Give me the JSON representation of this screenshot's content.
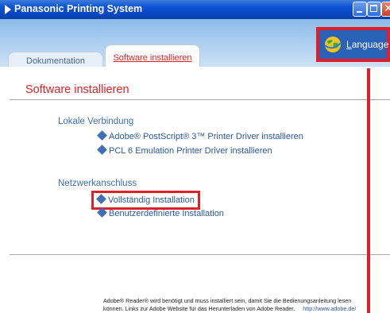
{
  "window": {
    "title": "Panasonic Printing System"
  },
  "header": {
    "language_accel": "L",
    "language_rest": "anguage",
    "tabs": [
      {
        "label": "Dokumentation",
        "active": false
      },
      {
        "label": "Software installieren",
        "active": true
      }
    ]
  },
  "main": {
    "title": "Software installieren",
    "sections": [
      {
        "heading": "Lokale Verbindung",
        "links": [
          "Adobe® PostScript® 3™ Printer Driver installieren",
          "PCL 6 Emulation Printer Driver installieren"
        ]
      },
      {
        "heading": "Netzwerkanschluss",
        "links": [
          "Vollständig Installation",
          "Benutzerdefinierte Installation"
        ]
      }
    ]
  },
  "footer": {
    "line1": "Adobe® Reader® wird benötigt und muss installiert sein, damit Sie die Bedienungsanleitung lesen",
    "line2": "können. Links zur Adobe Website für das Herunterladen von Adobe Reader.",
    "link": "http://www.adobe.de/"
  },
  "colors": {
    "accent_red": "#e01f26",
    "link_blue": "#2c57a3",
    "title_bar_blue": "#0d54d6"
  }
}
